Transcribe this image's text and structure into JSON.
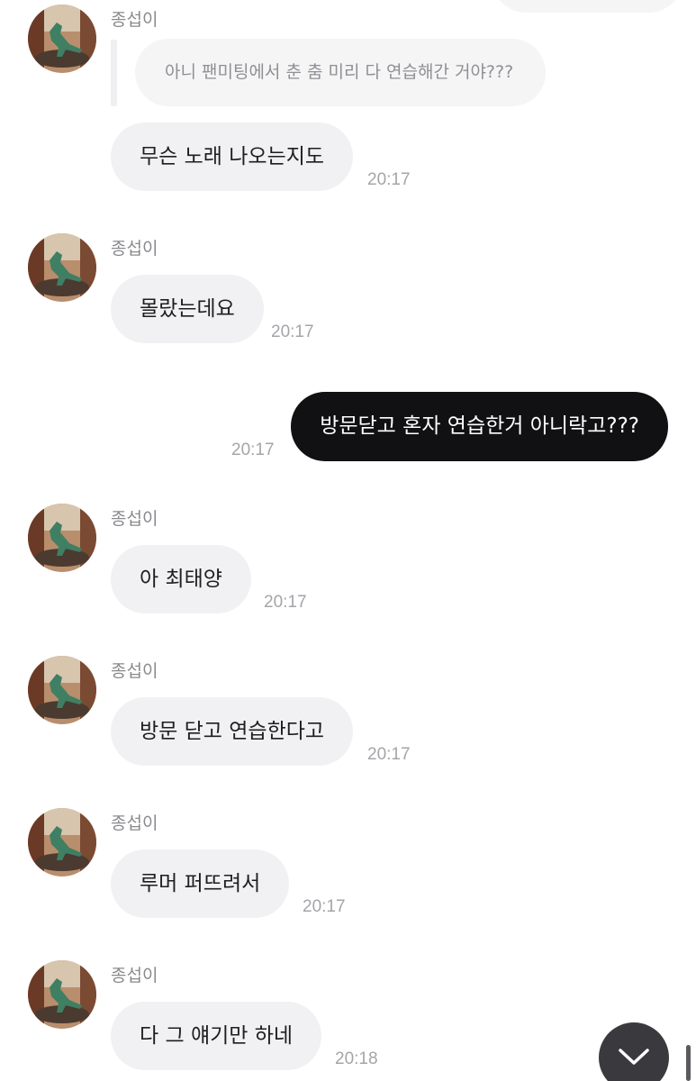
{
  "chat": {
    "quoted_message": "아니 팬미팅에서 춘 춤 미리 다 연습해간 거야???",
    "messages": [
      {
        "sender": "종섭이",
        "text": "무슨 노래 나오는지도",
        "time": "20:17"
      },
      {
        "sender": "종섭이",
        "text": "몰랐는데요",
        "time": "20:17"
      },
      {
        "sender": "",
        "text": "방문닫고 혼자 연습한거 아니락고???",
        "time": "20:17"
      },
      {
        "sender": "종섭이",
        "text": "아 최태양",
        "time": "20:17"
      },
      {
        "sender": "종섭이",
        "text": "방문 닫고 연습한다고",
        "time": "20:17"
      },
      {
        "sender": "종섭이",
        "text": "루머 퍼뜨려서",
        "time": "20:17"
      },
      {
        "sender": "종섭이",
        "text": "다 그 얘기만 하네",
        "time": "20:18"
      }
    ]
  },
  "icons": {
    "avatar": "dinosaur-figure-avatar",
    "scroll_button": "chevron-down-icon"
  },
  "colors": {
    "incoming_bubble": "#f1f1f3",
    "outgoing_bubble": "#111113",
    "scroll_button": "#3a3a3e"
  }
}
